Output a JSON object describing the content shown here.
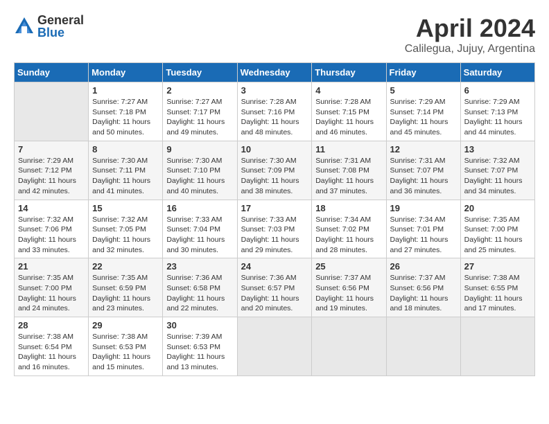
{
  "logo": {
    "general": "General",
    "blue": "Blue"
  },
  "title": "April 2024",
  "subtitle": "Calilegua, Jujuy, Argentina",
  "days_header": [
    "Sunday",
    "Monday",
    "Tuesday",
    "Wednesday",
    "Thursday",
    "Friday",
    "Saturday"
  ],
  "weeks": [
    [
      {
        "day": "",
        "info": ""
      },
      {
        "day": "1",
        "info": "Sunrise: 7:27 AM\nSunset: 7:18 PM\nDaylight: 11 hours\nand 50 minutes."
      },
      {
        "day": "2",
        "info": "Sunrise: 7:27 AM\nSunset: 7:17 PM\nDaylight: 11 hours\nand 49 minutes."
      },
      {
        "day": "3",
        "info": "Sunrise: 7:28 AM\nSunset: 7:16 PM\nDaylight: 11 hours\nand 48 minutes."
      },
      {
        "day": "4",
        "info": "Sunrise: 7:28 AM\nSunset: 7:15 PM\nDaylight: 11 hours\nand 46 minutes."
      },
      {
        "day": "5",
        "info": "Sunrise: 7:29 AM\nSunset: 7:14 PM\nDaylight: 11 hours\nand 45 minutes."
      },
      {
        "day": "6",
        "info": "Sunrise: 7:29 AM\nSunset: 7:13 PM\nDaylight: 11 hours\nand 44 minutes."
      }
    ],
    [
      {
        "day": "7",
        "info": "Sunrise: 7:29 AM\nSunset: 7:12 PM\nDaylight: 11 hours\nand 42 minutes."
      },
      {
        "day": "8",
        "info": "Sunrise: 7:30 AM\nSunset: 7:11 PM\nDaylight: 11 hours\nand 41 minutes."
      },
      {
        "day": "9",
        "info": "Sunrise: 7:30 AM\nSunset: 7:10 PM\nDaylight: 11 hours\nand 40 minutes."
      },
      {
        "day": "10",
        "info": "Sunrise: 7:30 AM\nSunset: 7:09 PM\nDaylight: 11 hours\nand 38 minutes."
      },
      {
        "day": "11",
        "info": "Sunrise: 7:31 AM\nSunset: 7:08 PM\nDaylight: 11 hours\nand 37 minutes."
      },
      {
        "day": "12",
        "info": "Sunrise: 7:31 AM\nSunset: 7:07 PM\nDaylight: 11 hours\nand 36 minutes."
      },
      {
        "day": "13",
        "info": "Sunrise: 7:32 AM\nSunset: 7:07 PM\nDaylight: 11 hours\nand 34 minutes."
      }
    ],
    [
      {
        "day": "14",
        "info": "Sunrise: 7:32 AM\nSunset: 7:06 PM\nDaylight: 11 hours\nand 33 minutes."
      },
      {
        "day": "15",
        "info": "Sunrise: 7:32 AM\nSunset: 7:05 PM\nDaylight: 11 hours\nand 32 minutes."
      },
      {
        "day": "16",
        "info": "Sunrise: 7:33 AM\nSunset: 7:04 PM\nDaylight: 11 hours\nand 30 minutes."
      },
      {
        "day": "17",
        "info": "Sunrise: 7:33 AM\nSunset: 7:03 PM\nDaylight: 11 hours\nand 29 minutes."
      },
      {
        "day": "18",
        "info": "Sunrise: 7:34 AM\nSunset: 7:02 PM\nDaylight: 11 hours\nand 28 minutes."
      },
      {
        "day": "19",
        "info": "Sunrise: 7:34 AM\nSunset: 7:01 PM\nDaylight: 11 hours\nand 27 minutes."
      },
      {
        "day": "20",
        "info": "Sunrise: 7:35 AM\nSunset: 7:00 PM\nDaylight: 11 hours\nand 25 minutes."
      }
    ],
    [
      {
        "day": "21",
        "info": "Sunrise: 7:35 AM\nSunset: 7:00 PM\nDaylight: 11 hours\nand 24 minutes."
      },
      {
        "day": "22",
        "info": "Sunrise: 7:35 AM\nSunset: 6:59 PM\nDaylight: 11 hours\nand 23 minutes."
      },
      {
        "day": "23",
        "info": "Sunrise: 7:36 AM\nSunset: 6:58 PM\nDaylight: 11 hours\nand 22 minutes."
      },
      {
        "day": "24",
        "info": "Sunrise: 7:36 AM\nSunset: 6:57 PM\nDaylight: 11 hours\nand 20 minutes."
      },
      {
        "day": "25",
        "info": "Sunrise: 7:37 AM\nSunset: 6:56 PM\nDaylight: 11 hours\nand 19 minutes."
      },
      {
        "day": "26",
        "info": "Sunrise: 7:37 AM\nSunset: 6:56 PM\nDaylight: 11 hours\nand 18 minutes."
      },
      {
        "day": "27",
        "info": "Sunrise: 7:38 AM\nSunset: 6:55 PM\nDaylight: 11 hours\nand 17 minutes."
      }
    ],
    [
      {
        "day": "28",
        "info": "Sunrise: 7:38 AM\nSunset: 6:54 PM\nDaylight: 11 hours\nand 16 minutes."
      },
      {
        "day": "29",
        "info": "Sunrise: 7:38 AM\nSunset: 6:53 PM\nDaylight: 11 hours\nand 15 minutes."
      },
      {
        "day": "30",
        "info": "Sunrise: 7:39 AM\nSunset: 6:53 PM\nDaylight: 11 hours\nand 13 minutes."
      },
      {
        "day": "",
        "info": ""
      },
      {
        "day": "",
        "info": ""
      },
      {
        "day": "",
        "info": ""
      },
      {
        "day": "",
        "info": ""
      }
    ]
  ]
}
